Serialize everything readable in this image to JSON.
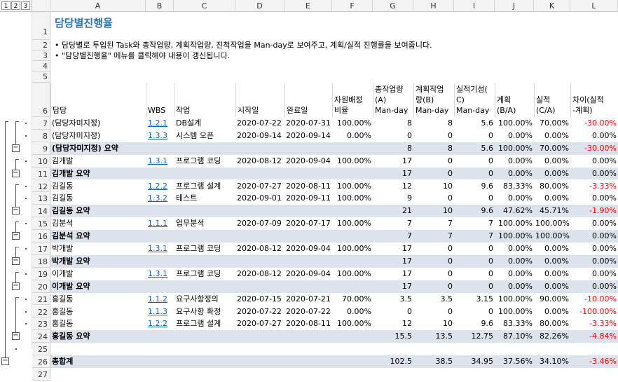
{
  "outline_levels": [
    "1",
    "2",
    "3"
  ],
  "columns": [
    "A",
    "B",
    "C",
    "D",
    "E",
    "F",
    "G",
    "H",
    "I",
    "J",
    "K",
    "L"
  ],
  "title": "담당별진행율",
  "notes": [
    "• 담당별로 투입된 Task와 총작업량, 계획작업량, 진척작업을 Man-day로 보여주고, 계획/실적 진행률을 보여줍니다.",
    "• \"담당별진행율\" 메뉴를 클릭해야 내용이 갱신됩니다."
  ],
  "header_row_numbers": [
    "1",
    "2",
    "3",
    "4",
    "5",
    "6"
  ],
  "table_header": {
    "a": "담당",
    "b": "WBS",
    "c": "작업",
    "d": "시작일",
    "e": "완료일",
    "f": [
      "자원배정",
      "비율"
    ],
    "g": [
      "총작업량",
      "(A)",
      "Man-day"
    ],
    "h": [
      "계획작업",
      "량(B)",
      "Man-day"
    ],
    "i": [
      "실적기성(",
      "C)",
      "Man-day"
    ],
    "j": [
      "계획",
      "(B/A)"
    ],
    "k": [
      "실적",
      "(C/A)"
    ],
    "l": [
      "차이(실적",
      "-계획)"
    ]
  },
  "rows": [
    {
      "num": "7",
      "a": "(담당자미지정)",
      "b": "1.2.1",
      "c": "DB설계",
      "d": "2020-07-22",
      "e": "2020-07-31",
      "f": "100.00%",
      "g": "8",
      "h": "8",
      "i": "5.6",
      "j": "100.00%",
      "k": "70.00%",
      "l": "-30.00%",
      "summary": false,
      "neg": true
    },
    {
      "num": "8",
      "a": "(담당자미지정)",
      "b": "1.3.3",
      "c": "시스템 오픈",
      "d": "2020-09-14",
      "e": "2020-09-14",
      "f": "0.00%",
      "g": "0",
      "h": "0",
      "i": "0",
      "j": "0.00%",
      "k": "0.00%",
      "l": "0.00%",
      "summary": false,
      "neg": false
    },
    {
      "num": "9",
      "a": "(담당자미지정) 요약",
      "b": "",
      "c": "",
      "d": "",
      "e": "",
      "f": "",
      "g": "8",
      "h": "8",
      "i": "5.6",
      "j": "100.00%",
      "k": "70.00%",
      "l": "-30.00%",
      "summary": true,
      "neg": true
    },
    {
      "num": "10",
      "a": "김개발",
      "b": "1.3.1",
      "c": "프로그램 코딩",
      "d": "2020-08-12",
      "e": "2020-09-04",
      "f": "100.00%",
      "g": "17",
      "h": "0",
      "i": "0",
      "j": "0.00%",
      "k": "0.00%",
      "l": "0.00%",
      "summary": false,
      "neg": false
    },
    {
      "num": "11",
      "a": "김개발 요약",
      "b": "",
      "c": "",
      "d": "",
      "e": "",
      "f": "",
      "g": "17",
      "h": "0",
      "i": "0",
      "j": "0.00%",
      "k": "0.00%",
      "l": "0.00%",
      "summary": true,
      "neg": false
    },
    {
      "num": "12",
      "a": "김길동",
      "b": "1.2.2",
      "c": "프로그램 설계",
      "d": "2020-07-27",
      "e": "2020-08-11",
      "f": "100.00%",
      "g": "12",
      "h": "10",
      "i": "9.6",
      "j": "83.33%",
      "k": "80.00%",
      "l": "-3.33%",
      "summary": false,
      "neg": true
    },
    {
      "num": "13",
      "a": "김길동",
      "b": "1.3.2",
      "c": "테스트",
      "d": "2020-09-01",
      "e": "2020-09-11",
      "f": "100.00%",
      "g": "9",
      "h": "0",
      "i": "0",
      "j": "0.00%",
      "k": "0.00%",
      "l": "0.00%",
      "summary": false,
      "neg": false
    },
    {
      "num": "14",
      "a": "김길동 요약",
      "b": "",
      "c": "",
      "d": "",
      "e": "",
      "f": "",
      "g": "21",
      "h": "10",
      "i": "9.6",
      "j": "47.62%",
      "k": "45.71%",
      "l": "-1.90%",
      "summary": true,
      "neg": true
    },
    {
      "num": "15",
      "a": "김분석",
      "b": "1.1.1",
      "c": "업무분석",
      "d": "2020-07-09",
      "e": "2020-07-17",
      "f": "100.00%",
      "g": "7",
      "h": "7",
      "i": "7",
      "j": "100.00%",
      "k": "100.00%",
      "l": "0.00%",
      "summary": false,
      "neg": false
    },
    {
      "num": "16",
      "a": "김분석 요약",
      "b": "",
      "c": "",
      "d": "",
      "e": "",
      "f": "",
      "g": "7",
      "h": "7",
      "i": "7",
      "j": "100.00%",
      "k": "100.00%",
      "l": "0.00%",
      "summary": true,
      "neg": false
    },
    {
      "num": "17",
      "a": "박개발",
      "b": "1.3.1",
      "c": "프로그램 코딩",
      "d": "2020-08-12",
      "e": "2020-09-04",
      "f": "100.00%",
      "g": "17",
      "h": "0",
      "i": "0",
      "j": "0.00%",
      "k": "0.00%",
      "l": "0.00%",
      "summary": false,
      "neg": false
    },
    {
      "num": "18",
      "a": "박개발 요약",
      "b": "",
      "c": "",
      "d": "",
      "e": "",
      "f": "",
      "g": "17",
      "h": "0",
      "i": "0",
      "j": "0.00%",
      "k": "0.00%",
      "l": "0.00%",
      "summary": true,
      "neg": false
    },
    {
      "num": "19",
      "a": "이개발",
      "b": "1.3.1",
      "c": "프로그램 코딩",
      "d": "2020-08-12",
      "e": "2020-09-04",
      "f": "100.00%",
      "g": "17",
      "h": "0",
      "i": "0",
      "j": "0.00%",
      "k": "0.00%",
      "l": "0.00%",
      "summary": false,
      "neg": false
    },
    {
      "num": "20",
      "a": "이개발 요약",
      "b": "",
      "c": "",
      "d": "",
      "e": "",
      "f": "",
      "g": "17",
      "h": "0",
      "i": "0",
      "j": "0.00%",
      "k": "0.00%",
      "l": "0.00%",
      "summary": true,
      "neg": false
    },
    {
      "num": "21",
      "a": "홍길동",
      "b": "1.1.2",
      "c": "요구사항정의",
      "d": "2020-07-15",
      "e": "2020-07-21",
      "f": "70.00%",
      "g": "3.5",
      "h": "3.5",
      "i": "3.15",
      "j": "100.00%",
      "k": "90.00%",
      "l": "-10.00%",
      "summary": false,
      "neg": true
    },
    {
      "num": "22",
      "a": "홍길동",
      "b": "1.1.3",
      "c": "요구사항 확정",
      "d": "2020-07-22",
      "e": "2020-07-22",
      "f": "0.00%",
      "g": "0",
      "h": "0",
      "i": "0",
      "j": "100.00%",
      "k": "0.00%",
      "l": "-100.00%",
      "summary": false,
      "neg": true
    },
    {
      "num": "23",
      "a": "홍길동",
      "b": "1.2.2",
      "c": "프로그램 설계",
      "d": "2020-07-27",
      "e": "2020-08-11",
      "f": "100.00%",
      "g": "12",
      "h": "10",
      "i": "9.6",
      "j": "83.33%",
      "k": "80.00%",
      "l": "-3.33%",
      "summary": false,
      "neg": true
    },
    {
      "num": "24",
      "a": "홍길동 요약",
      "b": "",
      "c": "",
      "d": "",
      "e": "",
      "f": "",
      "g": "15.5",
      "h": "13.5",
      "i": "12.75",
      "j": "87.10%",
      "k": "82.26%",
      "l": "-4.84%",
      "summary": true,
      "neg": true
    },
    {
      "num": "25",
      "a": "",
      "b": "",
      "c": "",
      "d": "",
      "e": "",
      "f": "",
      "g": "",
      "h": "",
      "i": "",
      "j": "",
      "k": "",
      "l": "",
      "summary": false,
      "neg": false,
      "blank": true
    },
    {
      "num": "26",
      "a": "총합계",
      "b": "",
      "c": "",
      "d": "",
      "e": "",
      "f": "",
      "g": "102.5",
      "h": "38.5",
      "i": "34.95",
      "j": "37.56%",
      "k": "34.10%",
      "l": "-3.46%",
      "summary": true,
      "neg": true
    },
    {
      "num": "27",
      "a": "",
      "b": "",
      "c": "",
      "d": "",
      "e": "",
      "f": "",
      "g": "",
      "h": "",
      "i": "",
      "j": "",
      "k": "",
      "l": "",
      "summary": false,
      "neg": false,
      "blank": true
    }
  ],
  "outline_button_symbol": "−",
  "colors": {
    "title": "#2e75b6",
    "summary_fill": "#dde3ec",
    "negative": "#ff0000",
    "link": "#0563c1"
  }
}
